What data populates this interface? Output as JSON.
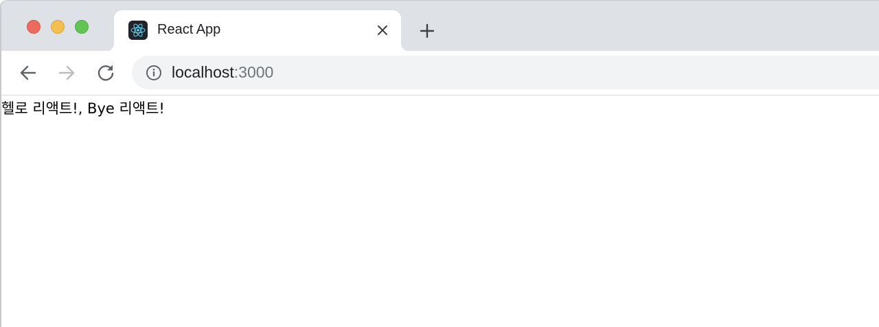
{
  "window": {
    "controls": [
      "close-button",
      "minimize-button",
      "maximize-button"
    ]
  },
  "tab": {
    "title": "React App",
    "favicon": "react-logo-icon",
    "close_icon": "close-icon"
  },
  "new_tab_icon": "plus-icon",
  "toolbar": {
    "back_icon": "arrow-left-icon",
    "forward_icon": "arrow-right-icon",
    "reload_icon": "reload-icon",
    "forward_enabled": false
  },
  "address_bar": {
    "info_icon": "info-icon",
    "host": "localhost",
    "port": ":3000"
  },
  "page": {
    "body_text": "헬로 리액트!, Bye 리액트!"
  },
  "colors": {
    "tabstrip_bg": "#dee1e6",
    "omnibox_bg": "#f1f3f4",
    "traffic_red": "#ed6a5e",
    "traffic_yellow": "#f5bf4f",
    "traffic_green": "#61c554",
    "react_cyan": "#61dafb"
  }
}
